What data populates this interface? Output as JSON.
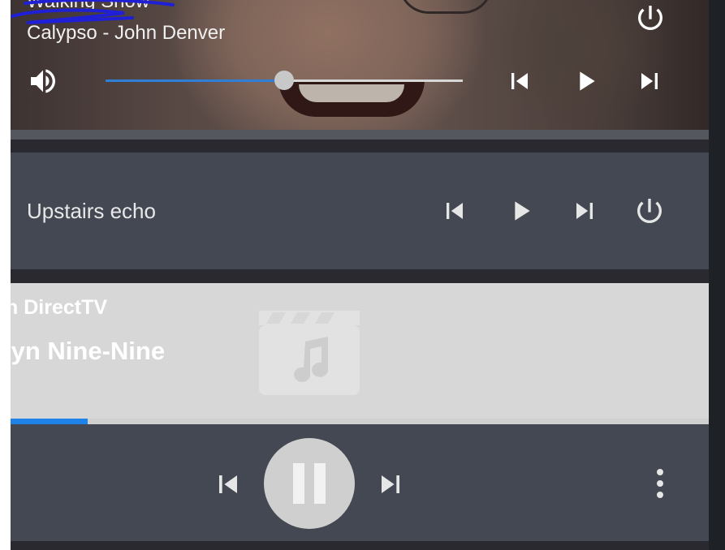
{
  "colors": {
    "accent": "#2f7fd8",
    "card_bg": "#434852",
    "light_card_bg": "#d7d7d7",
    "scribble": "#1f1fd6"
  },
  "card_now_playing": {
    "title": "Walking Snow",
    "artist": "Calypso - John Denver",
    "volume_percent": 50,
    "icons": [
      "power-icon",
      "volume-icon",
      "skip-previous-icon",
      "play-icon",
      "skip-next-icon"
    ]
  },
  "card_upstairs": {
    "name": "Upstairs echo",
    "icons": [
      "skip-previous-icon",
      "play-icon",
      "skip-next-icon",
      "power-icon"
    ]
  },
  "card_tv": {
    "source": "n DirectTV",
    "title": "lyn Nine-Nine",
    "progress_percent": 11,
    "icons": [
      "movie-music-icon",
      "skip-previous-icon",
      "pause-icon",
      "skip-next-icon",
      "more-vert-icon"
    ]
  }
}
